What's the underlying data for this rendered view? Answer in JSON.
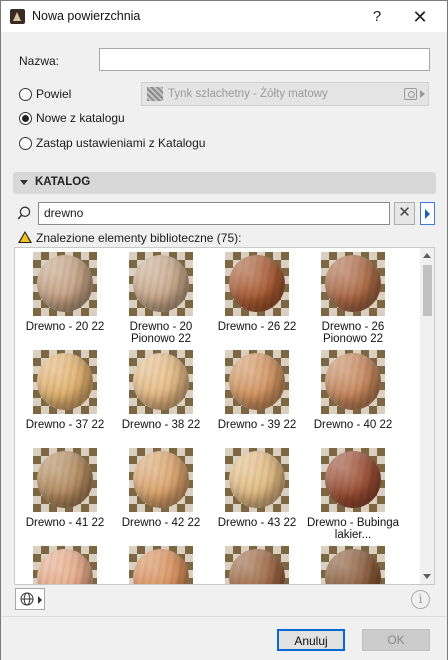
{
  "window": {
    "title": "Nowa powierzchnia",
    "help": "?",
    "close": "✕"
  },
  "name_field": {
    "label": "Nazwa:",
    "value": ""
  },
  "options": [
    {
      "label": "Powiel",
      "checked": false
    },
    {
      "label": "Nowe z katalogu",
      "checked": true
    },
    {
      "label": "Zastąp ustawieniami z Katalogu",
      "checked": false
    }
  ],
  "material_select": {
    "value": "Tynk szlachetny - Żółty matowy"
  },
  "catalog": {
    "title": "KATALOG",
    "search_value": "drewno",
    "clear": "✕",
    "found_text": "Znalezione elementy biblioteczne (75):",
    "items": [
      {
        "label": "Drewno - 20 22",
        "color": "#c4a283"
      },
      {
        "label": "Drewno - 20 Pionowo 22",
        "color": "#c9a98b"
      },
      {
        "label": "Drewno - 26 22",
        "color": "#a85a32"
      },
      {
        "label": "Drewno - 26 Pionowo 22",
        "color": "#ad6a45"
      },
      {
        "label": "Drewno - 37 22",
        "color": "#e2b16e"
      },
      {
        "label": "Drewno - 38 22",
        "color": "#e6ba84"
      },
      {
        "label": "Drewno - 39 22",
        "color": "#d49561"
      },
      {
        "label": "Drewno - 40 22",
        "color": "#c7865a"
      },
      {
        "label": "Drewno - 41 22",
        "color": "#b48b5e"
      },
      {
        "label": "Drewno - 42 22",
        "color": "#dba46c"
      },
      {
        "label": "Drewno - 43 22",
        "color": "#e3bb82"
      },
      {
        "label": "Drewno - Bubinga lakier...",
        "color": "#9a4c32"
      },
      {
        "label": "",
        "color": "#e6a987"
      },
      {
        "label": "",
        "color": "#d88f5a"
      },
      {
        "label": "",
        "color": "#9c6641"
      },
      {
        "label": "",
        "color": "#8a5a38"
      }
    ]
  },
  "footer": {
    "cancel": "Anuluj",
    "ok": "OK",
    "info": "i"
  }
}
